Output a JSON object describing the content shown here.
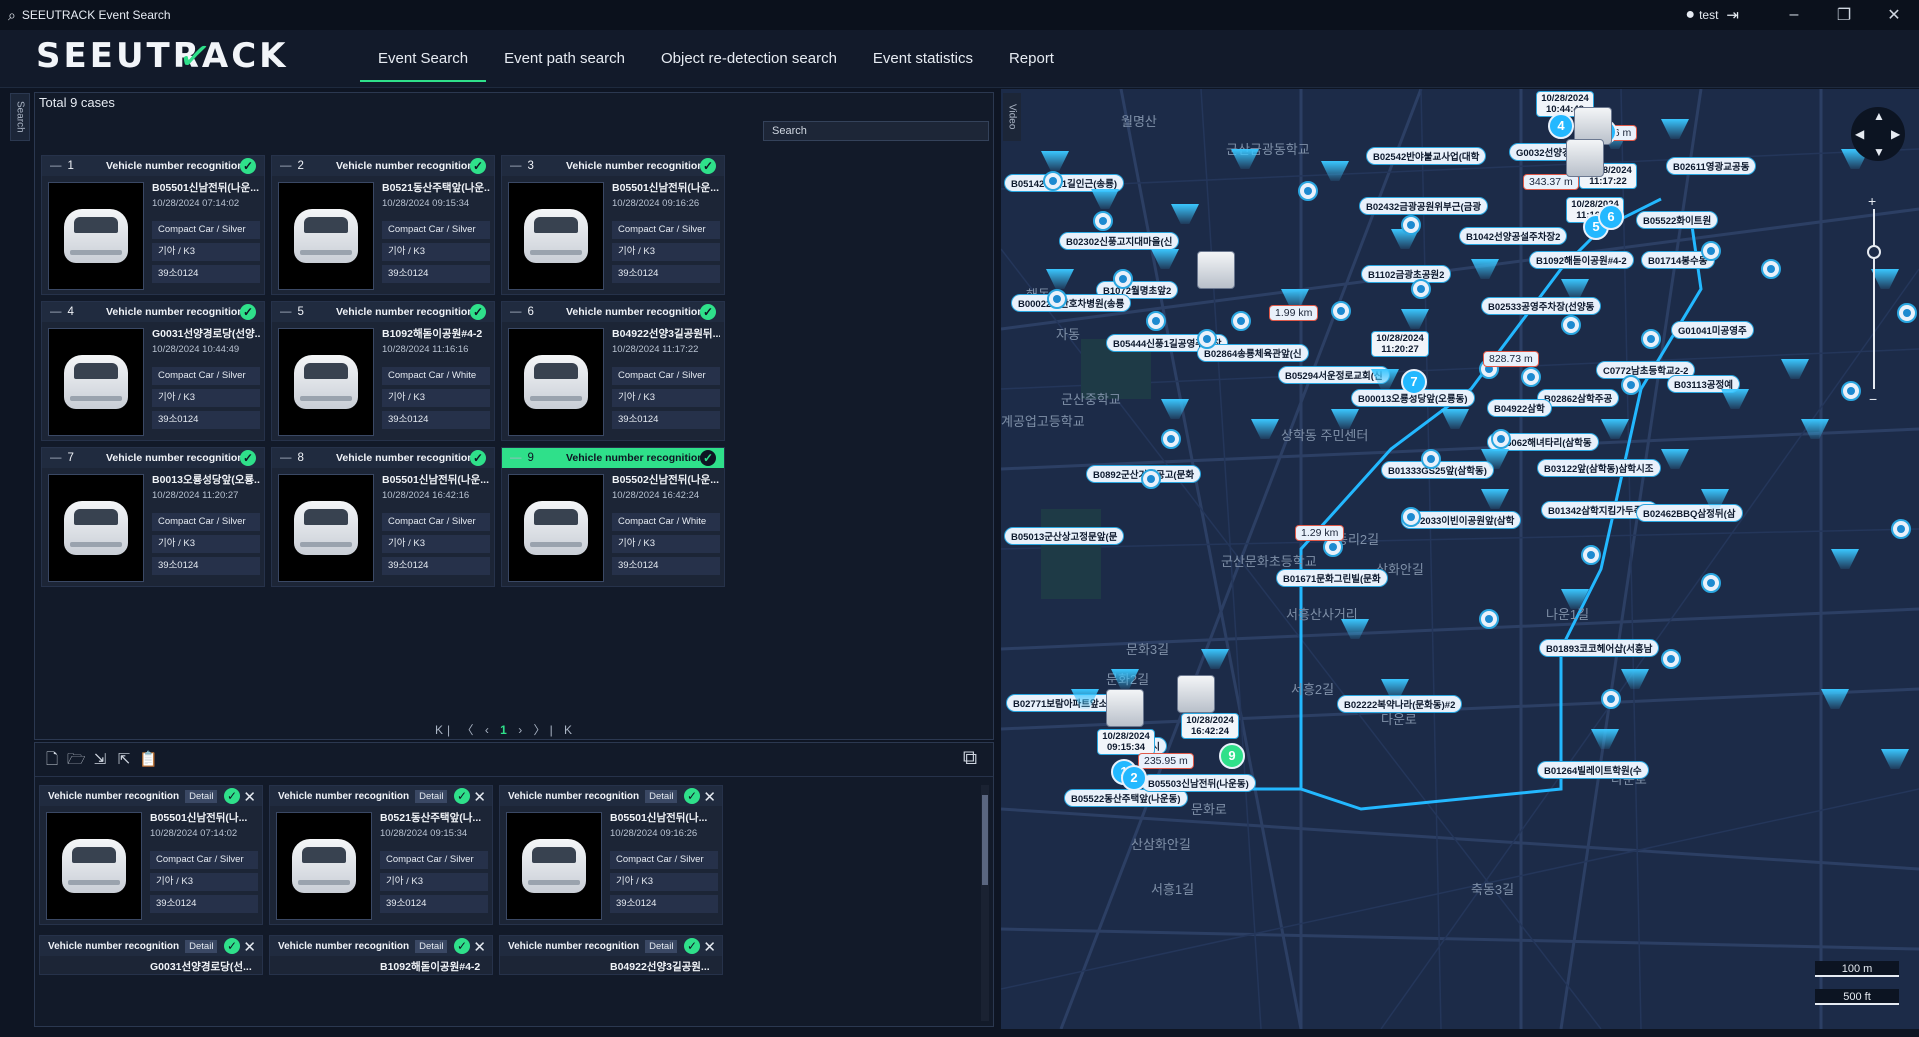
{
  "app": {
    "title": "SEEUTRACK Event Search",
    "user": "test"
  },
  "logo": {
    "text": "SEEUTRACK"
  },
  "nav": {
    "tabs": [
      "Event Search",
      "Event path search",
      "Object re-detection search",
      "Event statistics",
      "Report"
    ],
    "active": 0
  },
  "side_tabs": {
    "search": "Search",
    "video": "Video"
  },
  "results": {
    "total": "Total 9 cases",
    "search_placeholder": "Search",
    "cards": [
      {
        "num": "1",
        "title": "Vehicle number recognition",
        "name": "B05501신남전뒤(나운...",
        "date": "10/28/2024 07:14:02",
        "type": "Compact Car / Silver",
        "model": "기아 / K3",
        "plate": "39소0124"
      },
      {
        "num": "2",
        "title": "Vehicle number recognition",
        "name": "B0521동산주택앞(나운...",
        "date": "10/28/2024 09:15:34",
        "type": "Compact Car / Silver",
        "model": "기아 / K3",
        "plate": "39소0124"
      },
      {
        "num": "3",
        "title": "Vehicle number recognition",
        "name": "B05501신남전뒤(나운...",
        "date": "10/28/2024 09:16:26",
        "type": "Compact Car / Silver",
        "model": "기아 / K3",
        "plate": "39소0124"
      },
      {
        "num": "4",
        "title": "Vehicle number recognition",
        "name": "G0031선양경로당(선양...",
        "date": "10/28/2024 10:44:49",
        "type": "Compact Car / Silver",
        "model": "기아 / K3",
        "plate": "39소0124"
      },
      {
        "num": "5",
        "title": "Vehicle number recognition",
        "name": "B1092해돋이공원#4-2",
        "date": "10/28/2024 11:16:16",
        "type": "Compact Car / White",
        "model": "기아 / K3",
        "plate": "39소0124"
      },
      {
        "num": "6",
        "title": "Vehicle number recognition",
        "name": "B04922선양3길공원뒤...",
        "date": "10/28/2024 11:17:22",
        "type": "Compact Car / Silver",
        "model": "기아 / K3",
        "plate": "39소0124"
      },
      {
        "num": "7",
        "title": "Vehicle number recognition",
        "name": "B0013오룡성당앞(오룡...",
        "date": "10/28/2024 11:20:27",
        "type": "Compact Car / Silver",
        "model": "기아 / K3",
        "plate": "39소0124"
      },
      {
        "num": "8",
        "title": "Vehicle number recognition",
        "name": "B05501신남전뒤(나운...",
        "date": "10/28/2024 16:42:16",
        "type": "Compact Car / Silver",
        "model": "기아 / K3",
        "plate": "39소0124"
      },
      {
        "num": "9",
        "title": "Vehicle number recognition",
        "name": "B05502신남전뒤(나운...",
        "date": "10/28/2024 16:42:24",
        "type": "Compact Car / White",
        "model": "기아 / K3",
        "plate": "39소0124"
      }
    ],
    "pager": {
      "first": "K",
      "prev_group": "〈",
      "prev": "‹",
      "current": "1",
      "next": "›",
      "next_group": "〉",
      "last": "K"
    }
  },
  "watch": {
    "detail_label": "Detail",
    "cards": [
      {
        "title": "Vehicle number recognition",
        "name": "B05501신남전뒤(나...",
        "date": "10/28/2024 07:14:02",
        "type": "Compact Car / Silver",
        "model": "기아 / K3",
        "plate": "39소0124"
      },
      {
        "title": "Vehicle number recognition",
        "name": "B0521동산주택앞(나...",
        "date": "10/28/2024 09:15:34",
        "type": "Compact Car / Silver",
        "model": "기아 / K3",
        "plate": "39소0124"
      },
      {
        "title": "Vehicle number recognition",
        "name": "B05501신남전뒤(나...",
        "date": "10/28/2024 09:16:26",
        "type": "Compact Car / Silver",
        "model": "기아 / K3",
        "plate": "39소0124"
      },
      {
        "title": "Vehicle number recognition",
        "name": "G0031선양경로당(선...",
        "date": "",
        "type": "",
        "model": "",
        "plate": ""
      },
      {
        "title": "Vehicle number recognition",
        "name": "B1092해돋이공원#4-2",
        "date": "",
        "type": "",
        "model": "",
        "plate": ""
      },
      {
        "title": "Vehicle number recognition",
        "name": "B04922선양3길공원...",
        "date": "",
        "type": "",
        "model": "",
        "plate": ""
      }
    ]
  },
  "map": {
    "places": [
      "월명산",
      "군산금광동학교",
      "군산중학교",
      "계공업고등학교",
      "상학동 주민센터",
      "군산문화초등학교",
      "문화3길",
      "문화2길",
      "서흥산사거리",
      "서흥2길",
      "동리2길",
      "상화안길",
      "문화로",
      "산삼화안길",
      "나운1길",
      "나운로",
      "서흥1길",
      "축동3길",
      "다운로",
      "해돋",
      "자동"
    ],
    "labels": [
      "B05142송신1길인근(송룡)",
      "B02302신풍고지대마을(신",
      "B1072월명초앞2",
      "B00022군산호차병원(송룡",
      "B05444신풍1길공영주차장",
      "B02864송룡체육관앞(신",
      "B05294서운정로교회(신",
      "B00013오룡성당앞(오룡동)",
      "B0892군산기계공고(문화",
      "B05013군산상고정문앞(문",
      "B01671문화그린빌(문화",
      "B02771보람아파트앞소공",
      "B05522동산주택앞(나운동)",
      "B05503신남전뒤(나운동)",
      "B02542반야불교사업(대학",
      "B02432금광공원위부근(금광",
      "B1042선양공설주차장2",
      "B1102금광초공원2",
      "B1092해돋이공원#4-2",
      "B02533공영주차장(선양동",
      "B05522화이트원",
      "B02611영광교공동",
      "B01714봉수동",
      "B01333GS25앞(삼학동)",
      "B02033이빈이공원앞(삼학",
      "B05062해녀타리(삼학동",
      "B03122앞(삼학동)삼학시조",
      "B01342삼학지킴가두족산",
      "B02462BBQ삼정뒤(삼",
      "B01893코코헤어샵(서흥남",
      "B02222복약나라(문화동)#2",
      "B01264빌레이트학원(수",
      "C0772남초등학교2-2",
      "B03113공정예",
      "G0032선양경로",
      "B02862삼학주공",
      "B04922삼학",
      "G01041미공영주",
      "B00222시"
    ],
    "event_times": [
      "10/28/2024 10:44:49",
      "10/28/2024 11:17:22",
      "10/28/2024 11:16:16",
      "10/28/2024 11:20:27",
      "10/28/2024 09:15:34",
      "10/28/2024 16:42:24"
    ],
    "distances": [
      "343.37 m",
      "1.99 km",
      "828.73 m",
      "1.29 km",
      "235.95 m",
      "9.6 m"
    ],
    "seq": [
      "1",
      "2",
      "3",
      "4",
      "5",
      "6",
      "7",
      "9"
    ],
    "scale": [
      "100 m",
      "500 ft"
    ]
  },
  "colors": {
    "accent": "#2fe08a",
    "route": "#23b8ff",
    "map_bg": "#1c2b48",
    "panel": "#121a29"
  }
}
